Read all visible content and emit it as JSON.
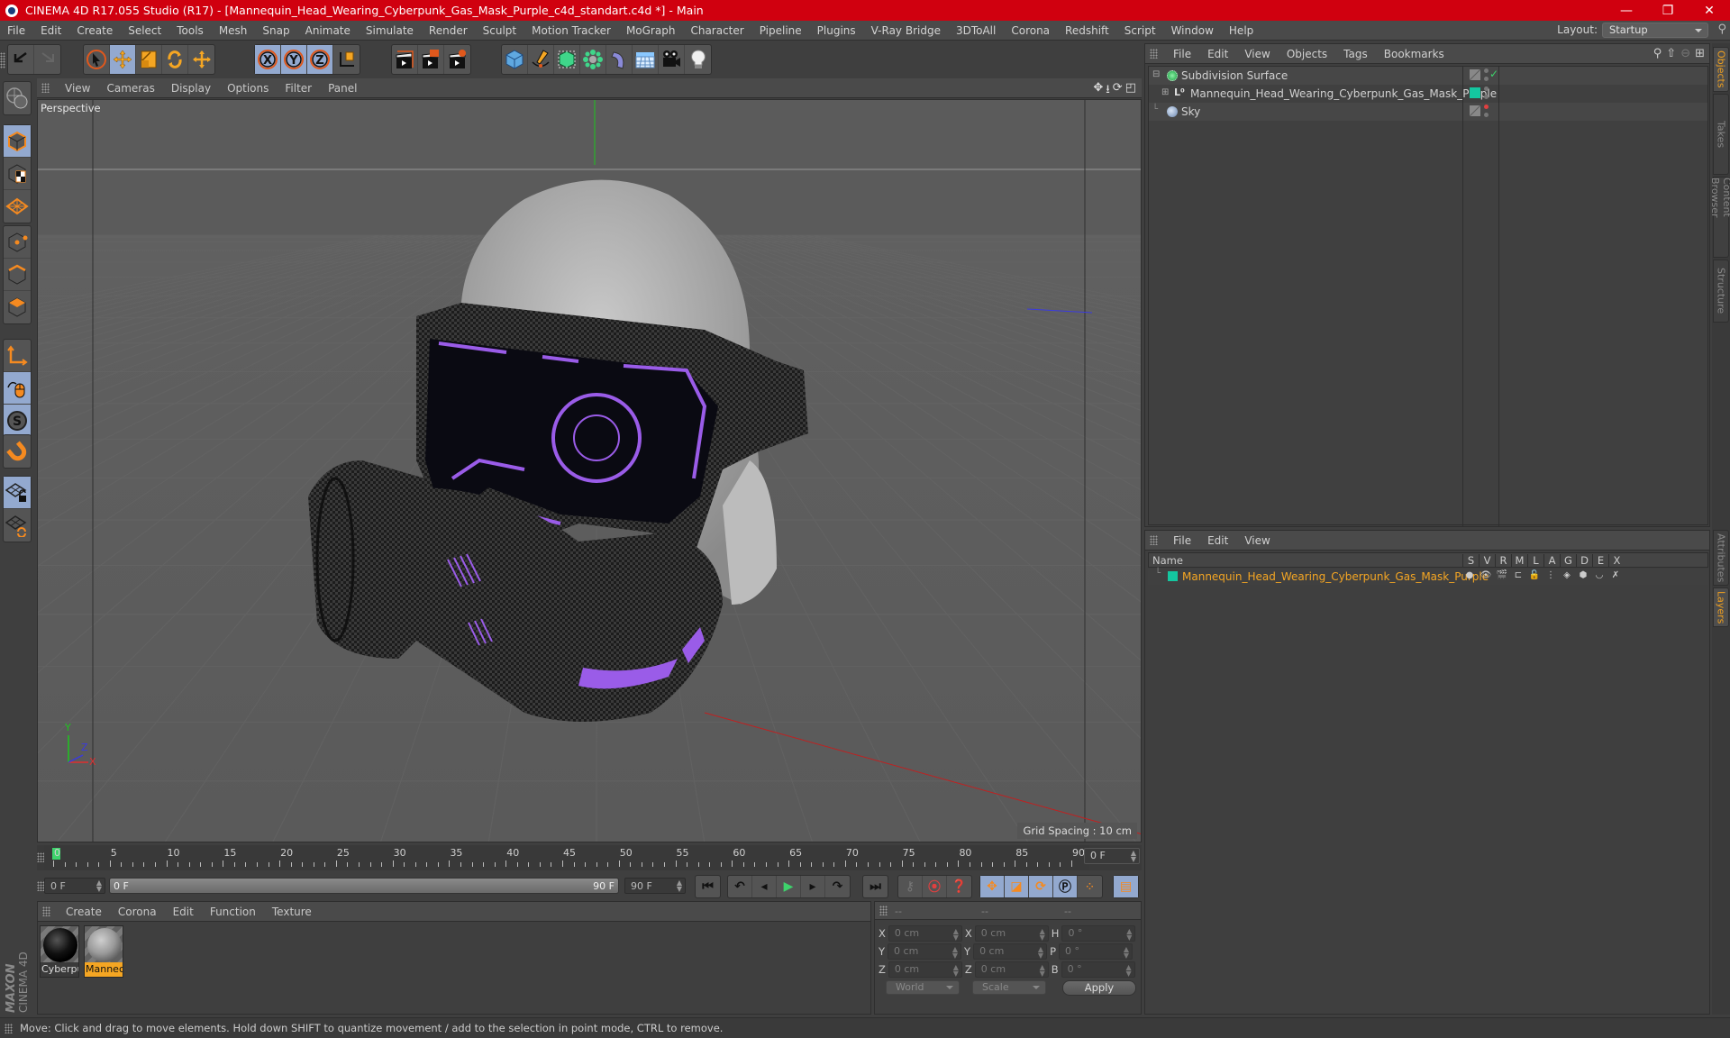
{
  "window": {
    "title": "CINEMA 4D R17.055 Studio (R17) - [Mannequin_Head_Wearing_Cyberpunk_Gas_Mask_Purple_c4d_standart.c4d *] - Main",
    "minimize": "—",
    "restore": "❐",
    "close": "✕"
  },
  "menubar": {
    "items": [
      "File",
      "Edit",
      "Create",
      "Select",
      "Tools",
      "Mesh",
      "Snap",
      "Animate",
      "Simulate",
      "Render",
      "Sculpt",
      "Motion Tracker",
      "MoGraph",
      "Character",
      "Pipeline",
      "Plugins",
      "V-Ray Bridge",
      "3DToAll",
      "Corona",
      "Redshift",
      "Script",
      "Window",
      "Help"
    ],
    "layout_label": "Layout:",
    "layout_value": "Startup"
  },
  "toolbar": {
    "groups": [
      [
        "undo-icon",
        "redo-icon"
      ],
      [
        "live-selection-icon",
        "move-icon",
        "scale-icon",
        "rotate-icon",
        "transform-icon"
      ],
      [
        "x-axis-lock-icon",
        "y-axis-lock-icon",
        "z-axis-lock-icon",
        "coordinate-system-icon"
      ],
      [
        "render-view-icon",
        "render-to-picture-viewer-icon",
        "render-settings-icon"
      ],
      [
        "cube-icon",
        "pen-spline-icon",
        "subdivision-icon",
        "array-icon",
        "deformer-icon",
        "floor-icon",
        "camera-icon",
        "light-icon"
      ]
    ],
    "active": [
      "move-icon",
      "x-axis-lock-icon",
      "y-axis-lock-icon",
      "z-axis-lock-icon"
    ]
  },
  "left_toolbar": {
    "items": [
      "make-editable-icon",
      "model-mode-icon",
      "texture-mode-icon",
      "workplane-mode-icon",
      "points-mode-icon",
      "edges-mode-icon",
      "polygons-mode-icon",
      "axis-mode-icon",
      "tweak-mode-icon",
      "snap-settings-icon",
      "magnet-icon",
      "workplane-lock-icon",
      "workplane-rotate-icon"
    ]
  },
  "viewport": {
    "menu": [
      "View",
      "Cameras",
      "Display",
      "Options",
      "Filter",
      "Panel"
    ],
    "label": "Perspective",
    "grid_spacing": "Grid Spacing : 10 cm",
    "axis_labels": {
      "x": "X",
      "y": "Y",
      "z": "Z"
    }
  },
  "timeline": {
    "ticks": [
      "0",
      "5",
      "10",
      "15",
      "20",
      "25",
      "30",
      "35",
      "40",
      "45",
      "50",
      "55",
      "60",
      "65",
      "70",
      "75",
      "80",
      "85",
      "90"
    ],
    "current_frame": "0 F",
    "start_field": "0 F",
    "range_start": "0 F",
    "range_end": "90 F",
    "end_field": "90 F",
    "max_frame": 90,
    "playhead_frame": 0
  },
  "transport": {
    "playback": [
      "go-to-start-icon",
      "previous-key-icon",
      "step-back-icon",
      "play-icon",
      "step-forward-icon",
      "next-key-icon",
      "go-to-end-icon"
    ],
    "keys": [
      "motion-record-icon",
      "record-active-icon",
      "autokey-icon"
    ],
    "key_tracks": [
      "key-position-icon",
      "key-scale-icon",
      "key-rotation-icon",
      "key-parameter-icon",
      "key-pla-icon"
    ],
    "timeline_btn": "timeline-window-icon"
  },
  "materials": {
    "menu": [
      "Create",
      "Corona",
      "Edit",
      "Function",
      "Texture"
    ],
    "items": [
      {
        "name": "Cyberpu",
        "selected": false,
        "color": "#111111"
      },
      {
        "name": "Mannec",
        "selected": true,
        "color": "#9a9a9a"
      }
    ]
  },
  "coordinates": {
    "headers": [
      "--",
      "--",
      "--"
    ],
    "rows": [
      {
        "a": "X",
        "pos": "0 cm",
        "b": "X",
        "size": "0 cm",
        "c": "H",
        "rot": "0 °"
      },
      {
        "a": "Y",
        "pos": "0 cm",
        "b": "Y",
        "size": "0 cm",
        "c": "P",
        "rot": "0 °"
      },
      {
        "a": "Z",
        "pos": "0 cm",
        "b": "Z",
        "size": "0 cm",
        "c": "B",
        "rot": "0 °"
      }
    ],
    "mode": "World",
    "size_mode": "Scale",
    "apply": "Apply"
  },
  "objects": {
    "menu": [
      "File",
      "Edit",
      "View",
      "Objects",
      "Tags",
      "Bookmarks"
    ],
    "items": [
      {
        "name": "Subdivision Surface",
        "icon": "subdivision-surface-icon",
        "depth": 0,
        "expand": "−",
        "check": "✓"
      },
      {
        "name": "Mannequin_Head_Wearing_Cyberpunk_Gas_Mask_Purple",
        "icon": "null-object-icon",
        "depth": 1,
        "expand": "+",
        "layer_color": "#14c7a0"
      },
      {
        "name": "Sky",
        "icon": "sky-icon",
        "depth": 0,
        "expand": ""
      }
    ]
  },
  "layers": {
    "menu": [
      "File",
      "Edit",
      "View"
    ],
    "columns": [
      "S",
      "V",
      "R",
      "M",
      "L",
      "A",
      "G",
      "D",
      "E",
      "X"
    ],
    "name_header": "Name",
    "items": [
      {
        "name": "Mannequin_Head_Wearing_Cyberpunk_Gas_Mask_Purple",
        "color": "#14c7a0"
      }
    ]
  },
  "right_tabs": {
    "top": [
      "Objects",
      "Takes",
      "Content Browser",
      "Structure"
    ],
    "bottom": [
      "Attributes",
      "Layers"
    ]
  },
  "brand": {
    "maxon": "MAXON",
    "product": "CINEMA 4D"
  },
  "status": "Move: Click and drag to move elements. Hold down SHIFT to quantize movement / add to the selection in point mode, CTRL to remove.",
  "colors": {
    "accent": "#f5a623",
    "title_bar": "#d0000f",
    "active_tool": "#93a9cf",
    "layer": "#14c7a0"
  }
}
